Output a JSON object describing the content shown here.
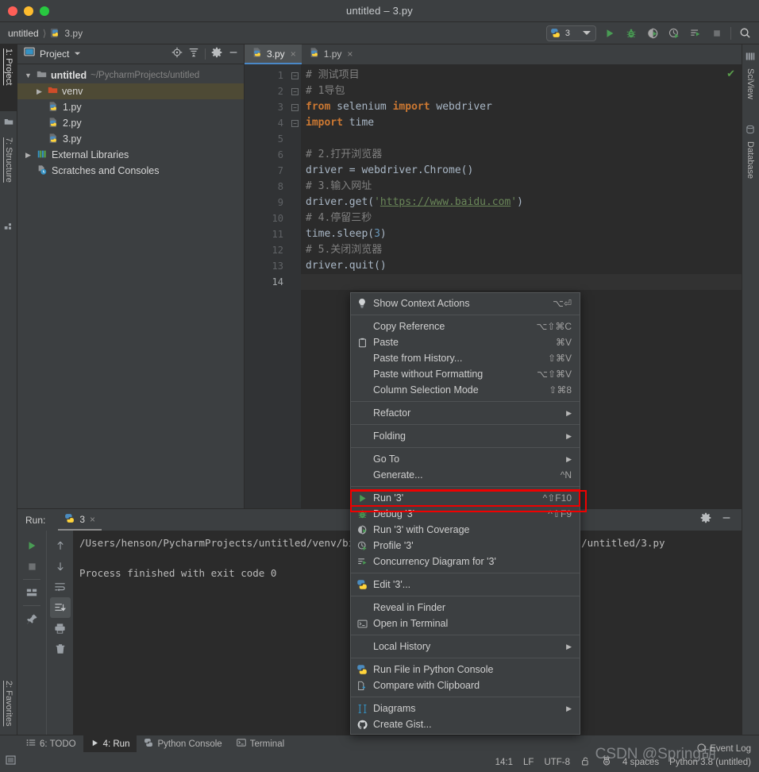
{
  "window": {
    "title": "untitled – 3.py",
    "traffic_lights": [
      "close",
      "minimize",
      "maximize"
    ]
  },
  "toolbar": {
    "breadcrumb": [
      "untitled",
      "3.py"
    ],
    "run_config": {
      "label": "3",
      "icon": "python-icon"
    },
    "buttons": [
      {
        "name": "run-button",
        "icon": "play-icon"
      },
      {
        "name": "debug-button",
        "icon": "bug-icon"
      },
      {
        "name": "run-coverage-button",
        "icon": "coverage-icon"
      },
      {
        "name": "profile-button",
        "icon": "profile-icon"
      },
      {
        "name": "concurrency-button",
        "icon": "concurrency-icon"
      },
      {
        "name": "stop-button",
        "icon": "stop-icon"
      },
      {
        "name": "search-everywhere-button",
        "icon": "search-icon"
      }
    ]
  },
  "left_strip": [
    {
      "label": "1: Project",
      "num": "1",
      "icon": "project-icon",
      "active": true
    },
    {
      "label": "7: Structure",
      "num": "7",
      "icon": "structure-icon",
      "active": false
    },
    {
      "label": "2: Favorites",
      "num": "2",
      "icon": "star-icon",
      "active": false
    }
  ],
  "right_strip": [
    {
      "label": "SciView",
      "icon": "sciview-icon"
    },
    {
      "label": "Database",
      "icon": "database-icon"
    }
  ],
  "project_panel": {
    "title": "Project",
    "tools": [
      "target-icon",
      "collapse-all-icon",
      "gear-icon",
      "hide-icon"
    ],
    "tree": [
      {
        "indent": 0,
        "twist": "▼",
        "icon": "folder-icon",
        "name": "untitled",
        "bold": true,
        "path": "~/PycharmProjects/untitled",
        "selected": false
      },
      {
        "indent": 1,
        "twist": "▶",
        "icon": "folder-orange-icon",
        "name": "venv",
        "bold": false,
        "path": "",
        "selected": true
      },
      {
        "indent": 2,
        "twist": "",
        "icon": "python-file-icon",
        "name": "1.py",
        "bold": false,
        "path": "",
        "selected": false
      },
      {
        "indent": 2,
        "twist": "",
        "icon": "python-file-icon",
        "name": "2.py",
        "bold": false,
        "path": "",
        "selected": false
      },
      {
        "indent": 2,
        "twist": "",
        "icon": "python-file-icon",
        "name": "3.py",
        "bold": false,
        "path": "",
        "selected": false
      },
      {
        "indent": 0,
        "twist": "▶",
        "icon": "libraries-icon",
        "name": "External Libraries",
        "bold": false,
        "path": "",
        "selected": false
      },
      {
        "indent": 0,
        "twist": "",
        "icon": "scratches-icon",
        "name": "Scratches and Consoles",
        "bold": false,
        "path": "",
        "selected": false
      }
    ]
  },
  "editor": {
    "tabs": [
      {
        "label": "3.py",
        "icon": "python-file-icon",
        "active": true,
        "close": "×"
      },
      {
        "label": "1.py",
        "icon": "python-file-icon",
        "active": false,
        "close": "×"
      }
    ],
    "inspection_ok": "✔",
    "line_count": 14,
    "lines": [
      {
        "n": 1,
        "fold": "box",
        "tokens": [
          {
            "t": "# 测试项目",
            "c": "cmt"
          }
        ]
      },
      {
        "n": 2,
        "fold": "box",
        "tokens": [
          {
            "t": "# 1导包",
            "c": "cmt"
          }
        ]
      },
      {
        "n": 3,
        "fold": "box",
        "tokens": [
          {
            "t": "from",
            "c": "kw"
          },
          {
            "t": " selenium ",
            "c": "pln"
          },
          {
            "t": "import",
            "c": "kw"
          },
          {
            "t": " webdriver",
            "c": "pln"
          }
        ]
      },
      {
        "n": 4,
        "fold": "box",
        "tokens": [
          {
            "t": "import",
            "c": "kw"
          },
          {
            "t": " time",
            "c": "pln"
          }
        ]
      },
      {
        "n": 5,
        "fold": "",
        "tokens": []
      },
      {
        "n": 6,
        "fold": "",
        "tokens": [
          {
            "t": "# 2.打开浏览器",
            "c": "cmt"
          }
        ]
      },
      {
        "n": 7,
        "fold": "",
        "tokens": [
          {
            "t": "driver = webdriver.Chrome()",
            "c": "pln"
          }
        ]
      },
      {
        "n": 8,
        "fold": "",
        "tokens": [
          {
            "t": "# 3.输入网址",
            "c": "cmt"
          }
        ]
      },
      {
        "n": 9,
        "fold": "",
        "tokens": [
          {
            "t": "driver.get(",
            "c": "pln"
          },
          {
            "t": "'",
            "c": "str"
          },
          {
            "t": "https://www.baidu.com",
            "c": "link"
          },
          {
            "t": "'",
            "c": "str"
          },
          {
            "t": ")",
            "c": "pln"
          }
        ]
      },
      {
        "n": 10,
        "fold": "",
        "tokens": [
          {
            "t": "# 4.停留三秒",
            "c": "cmt"
          }
        ]
      },
      {
        "n": 11,
        "fold": "",
        "tokens": [
          {
            "t": "time.sleep(",
            "c": "pln"
          },
          {
            "t": "3",
            "c": "num2"
          },
          {
            "t": ")",
            "c": "pln"
          }
        ]
      },
      {
        "n": 12,
        "fold": "",
        "tokens": [
          {
            "t": "# 5.关闭浏览器",
            "c": "cmt"
          }
        ]
      },
      {
        "n": 13,
        "fold": "",
        "tokens": [
          {
            "t": "driver.quit()",
            "c": "pln"
          }
        ]
      },
      {
        "n": 14,
        "fold": "",
        "tokens": []
      }
    ]
  },
  "context_menu": {
    "groups": [
      {
        "items": [
          {
            "label": "Show Context Actions",
            "accel": "⌥⏎",
            "icon": "lightbulb-icon",
            "submenu": false,
            "highlight": false
          }
        ]
      },
      {
        "items": [
          {
            "label": "Copy Reference",
            "accel": "⌥⇧⌘C",
            "icon": "",
            "submenu": false,
            "highlight": false
          },
          {
            "label": "Paste",
            "accel": "⌘V",
            "icon": "clipboard-icon",
            "submenu": false,
            "highlight": false
          },
          {
            "label": "Paste from History...",
            "accel": "⇧⌘V",
            "icon": "",
            "submenu": false,
            "highlight": false
          },
          {
            "label": "Paste without Formatting",
            "accel": "⌥⇧⌘V",
            "icon": "",
            "submenu": false,
            "highlight": false
          },
          {
            "label": "Column Selection Mode",
            "accel": "⇧⌘8",
            "icon": "",
            "submenu": false,
            "highlight": false
          }
        ]
      },
      {
        "items": [
          {
            "label": "Refactor",
            "accel": "",
            "icon": "",
            "submenu": true,
            "highlight": false
          }
        ]
      },
      {
        "items": [
          {
            "label": "Folding",
            "accel": "",
            "icon": "",
            "submenu": true,
            "highlight": false
          }
        ]
      },
      {
        "items": [
          {
            "label": "Go To",
            "accel": "",
            "icon": "",
            "submenu": true,
            "highlight": false
          },
          {
            "label": "Generate...",
            "accel": "^N",
            "icon": "",
            "submenu": false,
            "highlight": false
          }
        ]
      },
      {
        "items": [
          {
            "label": "Run '3'",
            "accel": "^⇧F10",
            "icon": "play-icon",
            "submenu": false,
            "highlight": true
          },
          {
            "label": "Debug '3'",
            "accel": "^⇧F9",
            "icon": "bug-icon",
            "submenu": false,
            "highlight": false
          },
          {
            "label": "Run '3' with Coverage",
            "accel": "",
            "icon": "coverage-icon",
            "submenu": false,
            "highlight": false
          },
          {
            "label": "Profile '3'",
            "accel": "",
            "icon": "profile-icon",
            "submenu": false,
            "highlight": false
          },
          {
            "label": "Concurrency Diagram for '3'",
            "accel": "",
            "icon": "concurrency-icon",
            "submenu": false,
            "highlight": false
          }
        ]
      },
      {
        "items": [
          {
            "label": "Edit '3'...",
            "accel": "",
            "icon": "python-icon",
            "submenu": false,
            "highlight": false
          }
        ]
      },
      {
        "items": [
          {
            "label": "Reveal in Finder",
            "accel": "",
            "icon": "",
            "submenu": false,
            "highlight": false
          },
          {
            "label": "Open in Terminal",
            "accel": "",
            "icon": "terminal-icon",
            "submenu": false,
            "highlight": false
          }
        ]
      },
      {
        "items": [
          {
            "label": "Local History",
            "accel": "",
            "icon": "",
            "submenu": true,
            "highlight": false
          }
        ]
      },
      {
        "items": [
          {
            "label": "Run File in Python Console",
            "accel": "",
            "icon": "python-icon",
            "submenu": false,
            "highlight": false
          },
          {
            "label": "Compare with Clipboard",
            "accel": "",
            "icon": "compare-icon",
            "submenu": false,
            "highlight": false
          }
        ]
      },
      {
        "items": [
          {
            "label": "Diagrams",
            "accel": "",
            "icon": "diagrams-icon",
            "submenu": true,
            "highlight": false
          },
          {
            "label": "Create Gist...",
            "accel": "",
            "icon": "github-icon",
            "submenu": false,
            "highlight": false
          }
        ]
      }
    ]
  },
  "run_panel": {
    "label": "Run:",
    "tab": {
      "label": "3",
      "icon": "python-icon",
      "close": "×"
    },
    "header_tools": [
      "gear-icon",
      "hide-icon"
    ],
    "toolbar_left": [
      "rerun-icon",
      "stop-icon",
      "layout-icon",
      "pin-icon"
    ],
    "toolbar_right": [
      "up-icon",
      "down-icon",
      "soft-wrap-icon",
      "scroll-to-end-icon",
      "print-icon",
      "trash-icon"
    ],
    "console_lines": [
      "/Users/henson/PycharmProjects/untitled/venv/bin/python /Users/henson/PycharmProjects/untitled/3.py",
      "",
      "Process finished with exit code 0"
    ]
  },
  "bottom_strip": [
    {
      "label": "6: TODO",
      "num": "6",
      "icon": "todo-icon",
      "active": false
    },
    {
      "label": "4: Run",
      "num": "4",
      "icon": "play-icon",
      "active": true
    },
    {
      "label": "Python Console",
      "num": "",
      "icon": "python-icon",
      "active": false
    },
    {
      "label": "Terminal",
      "num": "",
      "icon": "terminal-icon",
      "active": false
    }
  ],
  "status_bar": {
    "caret": "14:1",
    "line_separator": "LF",
    "encoding": "UTF-8",
    "lock_icon": "unlocked-icon",
    "inspection_icon": "inspection-icon",
    "indent": "4 spaces",
    "interpreter": "Python 3.8 (untitled)",
    "event_log": "Event Log",
    "watermark": "CSDN @Spring胡"
  },
  "colors": {
    "accent_green": "#499c54",
    "highlight_red": "#f00000",
    "selection": "#4e4a35",
    "editor_bg": "#2b2b2b",
    "panel_bg": "#3c3f41",
    "tab_active": "#4e88c7"
  }
}
